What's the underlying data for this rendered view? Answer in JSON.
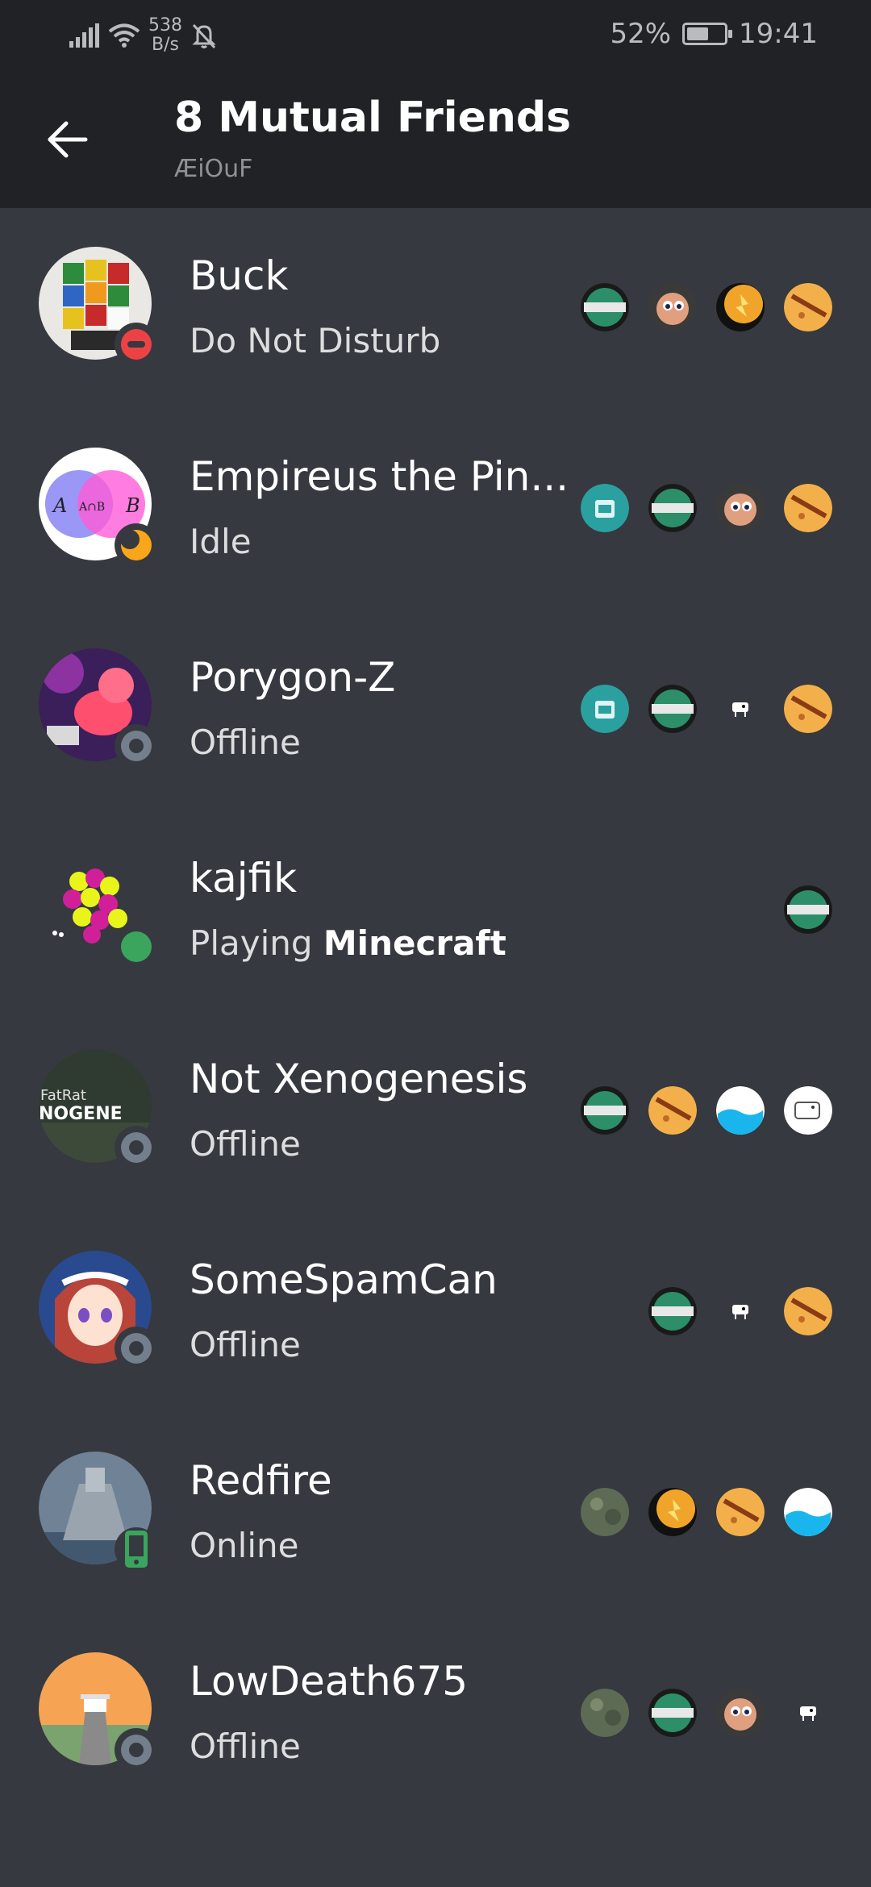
{
  "statusbar": {
    "speed_value": "538",
    "speed_unit": "B/s",
    "battery": "52%",
    "time": "19:41"
  },
  "header": {
    "title": "8 Mutual Friends",
    "subtitle": "ÆiOuF"
  },
  "friends": [
    {
      "name": "Buck",
      "status": "Do Not Disturb"
    },
    {
      "name": "Empireus the Pin...",
      "status": "Idle"
    },
    {
      "name": "Porygon-Z",
      "status": "Offline"
    },
    {
      "name": "kajfik",
      "status_prefix": "Playing ",
      "status_game": "Minecraft"
    },
    {
      "name": "Not Xenogenesis",
      "status": "Offline"
    },
    {
      "name": "SomeSpamCan",
      "status": "Offline"
    },
    {
      "name": "Redfire",
      "status": "Online"
    },
    {
      "name": "LowDeath675",
      "status": "Offline"
    }
  ],
  "avatar_text": {
    "empireus": {
      "a": "A",
      "ab": "A∩B",
      "b": "B"
    },
    "xeno": {
      "line1": "FatRat",
      "line2": "NOGENE"
    }
  },
  "colors": {
    "background": "#36393f",
    "header": "#202225",
    "dnd": "#ed4245",
    "idle": "#faa61a",
    "online": "#3ba55d",
    "offline": "#747f8d"
  }
}
